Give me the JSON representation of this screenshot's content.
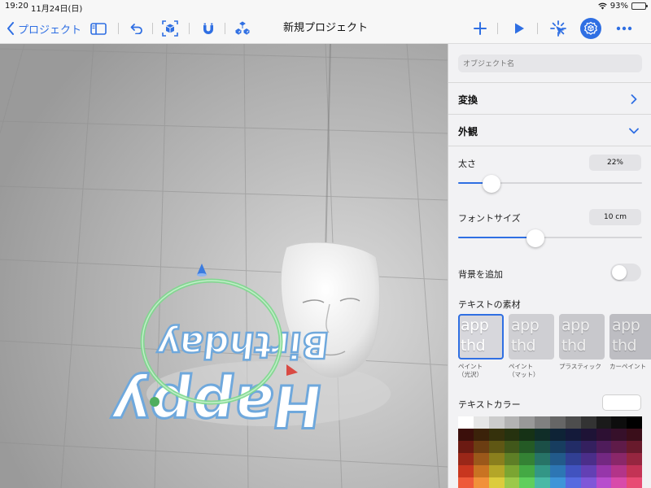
{
  "status": {
    "time": "19:20",
    "date": "11月24日(日)",
    "battery": "93%",
    "battery_level": 0.93
  },
  "toolbar": {
    "back_label": "プロジェクト",
    "title": "新規プロジェクト",
    "icons": [
      "sidebar-icon",
      "undo-icon",
      "ar-box-icon",
      "magnet-icon",
      "objects-icon",
      "plus-icon",
      "play-icon",
      "sparkle-icon",
      "settings-cube-icon",
      "more-icon"
    ]
  },
  "viewport": {
    "text_line_1": "Happy",
    "text_line_2": "Birthday"
  },
  "panel": {
    "object_name_placeholder": "オブジェクト名",
    "transform_title": "変換",
    "appearance_title": "外観",
    "thickness": {
      "label": "太さ",
      "value": "22%",
      "level": 0.18
    },
    "font_size": {
      "label": "フォントサイズ",
      "value": "10 cm",
      "level": 0.42
    },
    "background_toggle": {
      "label": "背景を追加",
      "on": false
    },
    "materials": {
      "label": "テキストの素材",
      "sample_text": "app thd",
      "items": [
        {
          "label": "ペイント",
          "label2": "（光沢）",
          "selected": true,
          "bg": "#d7d7dc",
          "fg": "#ffffff"
        },
        {
          "label": "ペイント",
          "label2": "（マット）",
          "selected": false,
          "bg": "#cfcfd3",
          "fg": "#f4f4f4"
        },
        {
          "label": "プラスティック",
          "label2": "",
          "selected": false,
          "bg": "#c8c8cc",
          "fg": "#f0f0f0"
        },
        {
          "label": "カーペイント",
          "label2": "",
          "selected": false,
          "bg": "#bdbdc2",
          "fg": "#eaeaea"
        }
      ]
    },
    "text_color": {
      "label": "テキストカラー",
      "value": "#ffffff"
    },
    "palette": [
      [
        "#ffffff",
        "#e6e6e6",
        "#cccccc",
        "#b3b3b3",
        "#999999",
        "#808080",
        "#666666",
        "#4d4d4d",
        "#333333",
        "#1a1a1a",
        "#0d0d0d",
        "#000000"
      ],
      [
        "#3b0f0b",
        "#3b220a",
        "#35310c",
        "#26320f",
        "#163216",
        "#102d28",
        "#0e2336",
        "#141a3a",
        "#1e1336",
        "#2d1033",
        "#36102a",
        "#3a0e1a"
      ],
      [
        "#6b1a12",
        "#6b3d12",
        "#5f5714",
        "#41571a",
        "#245a25",
        "#1b4f47",
        "#173d5f",
        "#222c66",
        "#34205f",
        "#4f1c5b",
        "#5f1b49",
        "#681a2c"
      ],
      [
        "#9a2718",
        "#9b581a",
        "#8a7f1d",
        "#5e7f26",
        "#348234",
        "#277367",
        "#225a8a",
        "#313f93",
        "#4b2e8a",
        "#732882",
        "#8a2769",
        "#962640"
      ],
      [
        "#c8361f",
        "#c97322",
        "#b4a628",
        "#7ba532",
        "#44a944",
        "#339686",
        "#2d76b4",
        "#4153bf",
        "#6340b4",
        "#9636aa",
        "#b33489",
        "#c33355"
      ],
      [
        "#ee5a3a",
        "#f1913a",
        "#dccc3d",
        "#9cc94a",
        "#5fcf5d",
        "#49b9a6",
        "#3e95d8",
        "#566be0",
        "#7f57d8",
        "#b74dcd",
        "#d84aaa",
        "#e84b73"
      ]
    ]
  }
}
